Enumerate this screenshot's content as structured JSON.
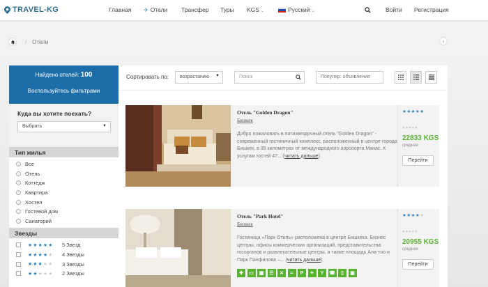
{
  "header": {
    "logo_text": "TRAVEL-KG",
    "nav": {
      "home": "Главная",
      "hotels": "Отели",
      "transfer": "Трансфер",
      "tours": "Туры",
      "currency": "KGS",
      "language": "Русский",
      "login": "Войти",
      "register": "Регистрация"
    }
  },
  "breadcrumb": {
    "current": "Отели"
  },
  "sidebar": {
    "found_label": "Найдено отелей:",
    "found_count": "100",
    "filter_label": "Воспользуйтесь фильтрами",
    "where_title": "Куда вы хотите поехать?",
    "where_select": "Выбрать",
    "housing_title": "Тип жилья",
    "housing_options": [
      "Все",
      "Отель",
      "Коттедж",
      "Квартира",
      "Хостел",
      "Гостевой дом",
      "Санаторий"
    ],
    "stars_title": "Звезды",
    "star_options": [
      {
        "label": "5 Звезд",
        "stars": 5
      },
      {
        "label": "4 Звезды",
        "stars": 4
      },
      {
        "label": "3 Звезды",
        "stars": 3
      },
      {
        "label": "2 Звезды",
        "stars": 2
      }
    ]
  },
  "toolbar": {
    "sort_label": "Сортировать по:",
    "sort_value": "возрастанию",
    "search_placeholder": "Поиск",
    "popular_value": "Популяр: объявления"
  },
  "hotels": [
    {
      "name": "Отель \"Golden Dragon\"",
      "city": "Бишкек",
      "description": "Добро пожаловать в пятизвездочный отель \"Golden Dragon\" - современный гостиничный комплекс, расположенный в центре города Бишкек, в 35 километрах от международного аэропорта Манас. К услугам гостей 47...",
      "read_more": "читать дальше",
      "stars": 5,
      "price": "22833 KGS",
      "price_note": "средняя",
      "button": "Перейти"
    },
    {
      "name": "Отель \"Park Hotel\"",
      "city": "Бишкек",
      "description": "Гостиница «Парк Отель» расположена в центре Бишкека. Бизнес центры, офисы коммерческих организаций, представительства госорганов и развлекательные центры, а также площадь Ала-тоо и Парк Панфилова –...",
      "read_more": "читать дальше",
      "stars": 4,
      "price": "20955 KGS",
      "price_note": "средняя",
      "button": "Перейти",
      "amenities": [
        "restaurant-icon",
        "bed-icon",
        "parking-icon",
        "wifi-icon",
        "gym-icon",
        "pool-icon",
        "parking-p-icon",
        "shower-icon",
        "bar-icon",
        "phone-icon",
        "fridge-icon",
        "tv-icon"
      ]
    }
  ],
  "colors": {
    "accent": "#1d6ea8",
    "price": "#5cb336",
    "stars": "#2c7fb8",
    "amenity": "#58b130"
  }
}
